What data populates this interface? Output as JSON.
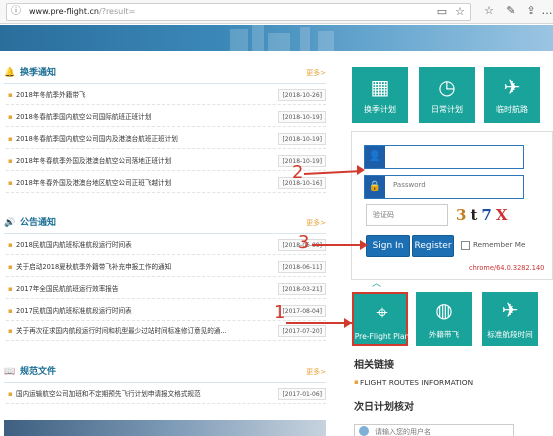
{
  "browser": {
    "url_host": "www.pre-flight.cn",
    "url_path": "/?result="
  },
  "sections": [
    {
      "title": "换季通知",
      "more": "更多>",
      "items": [
        {
          "text": "2018年冬航季外籍带飞",
          "date": "[2018-10-26]"
        },
        {
          "text": "2018冬春航季国内航空公司国际航班正班计划",
          "date": "[2018-10-19]"
        },
        {
          "text": "2018冬春航季国内航空公司国内及港澳台航班正班计划",
          "date": "[2018-10-19]"
        },
        {
          "text": "2018年冬春航季外国及港澳台航空公司落地正班计划",
          "date": "[2018-10-19]"
        },
        {
          "text": "2018年冬春外国及港澳台地区航空公司正班飞越计划",
          "date": "[2018-10-16]"
        }
      ]
    },
    {
      "title": "公告通知",
      "more": "更多>",
      "items": [
        {
          "text": "2018民航国内航班标准航段运行时间表",
          "date": "[2018-06-09]"
        },
        {
          "text": "关于启动2018夏秋航季外籍带飞补充申报工作的通知",
          "date": "[2018-06-11]"
        },
        {
          "text": "2017年全国民航航班运行效率报告",
          "date": "[2018-03-21]"
        },
        {
          "text": "2017民航国内航班标准航段运行时间表",
          "date": "[2017-08-04]"
        },
        {
          "text": "关于再次征求国内航段运行时间和机型最少过站时间标准修订意见的通...",
          "date": "[2017-07-20]"
        }
      ]
    },
    {
      "title": "规范文件",
      "more": "更多>",
      "items": [
        {
          "text": "国内运输航空公司加班和不定期预先飞行计划申请报文格式规范",
          "date": "[2017-01-06]"
        }
      ]
    }
  ],
  "tiles_top": [
    {
      "label": "换季计划",
      "icon": "calendar-icon"
    },
    {
      "label": "日常计划",
      "icon": "clock-document-icon"
    },
    {
      "label": "临时航路",
      "icon": "airplane-icon"
    }
  ],
  "login": {
    "username_value": "",
    "password_placeholder": "Password",
    "captcha_placeholder": "验证码",
    "captcha_text": "3t7X",
    "signin_label": "Sign In",
    "register_label": "Register",
    "remember_label": "Remember Me",
    "chrome_version": "chrome/64.0.3282.140"
  },
  "tiles_bottom": [
    {
      "label": "Pre-Flight Plan",
      "icon": "map-pin-icon"
    },
    {
      "label": "外籍带飞",
      "icon": "globe-plane-icon"
    },
    {
      "label": "标准航段时间",
      "icon": "takeoff-icon"
    }
  ],
  "links": {
    "title": "相关链接",
    "item": "FLIGHT ROUTES INFORMATION"
  },
  "next_day": {
    "title": "次日计划核对",
    "user_placeholder": "请输入您的用户名"
  },
  "annotations": [
    "1",
    "2",
    "3"
  ],
  "colors": {
    "teal": "#1aa39a",
    "blue": "#1d6fb3",
    "annotation_red": "#d23a2e",
    "more_orange": "#e8a33c"
  }
}
